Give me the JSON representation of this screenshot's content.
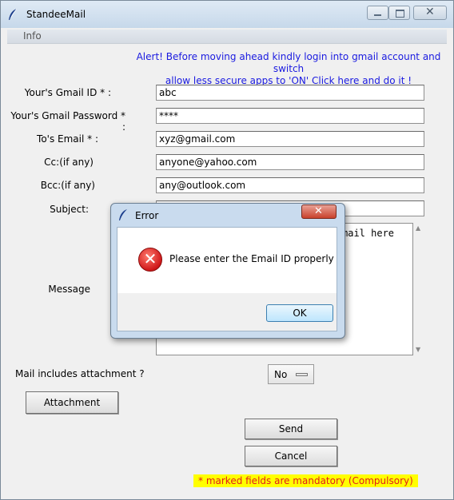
{
  "window": {
    "title": "StandeeMail",
    "icon": "feather-icon"
  },
  "menubar": {
    "items": [
      "Info"
    ]
  },
  "alert": {
    "line1": "Alert! Before moving ahead kindly login into gmail account and switch",
    "line2": "allow less secure apps to 'ON' Click here and do it !"
  },
  "form": {
    "gmail_id": {
      "label": "Your's Gmail ID * :",
      "value": "abc"
    },
    "gmail_password": {
      "label": "Your's Gmail Password * :",
      "value": "****"
    },
    "to_email": {
      "label": "To's Email * :",
      "value": "xyz@gmail.com"
    },
    "cc": {
      "label": "Cc:(if any)",
      "value": "anyone@yahoo.com"
    },
    "bcc": {
      "label": "Bcc:(if any)",
      "value": "any@outlook.com"
    },
    "subject": {
      "label": "Subject:",
      "value": ""
    },
    "message": {
      "label": "Message",
      "visible_text": "mail here"
    },
    "attachment_question": {
      "label": "Mail includes attachment ?",
      "selected": "No"
    }
  },
  "buttons": {
    "attachment": "Attachment",
    "send": "Send",
    "cancel": "Cancel"
  },
  "footer": {
    "mandatory_note": "* marked fields are mandatory (Compulsory)"
  },
  "dialog": {
    "title": "Error",
    "message": "Please enter the Email ID properly",
    "ok_label": "OK",
    "icon": "error-icon"
  },
  "colors": {
    "alert_text": "#1a1ae0",
    "mandatory_bg": "#ffff00",
    "mandatory_text": "#e21b1b"
  }
}
